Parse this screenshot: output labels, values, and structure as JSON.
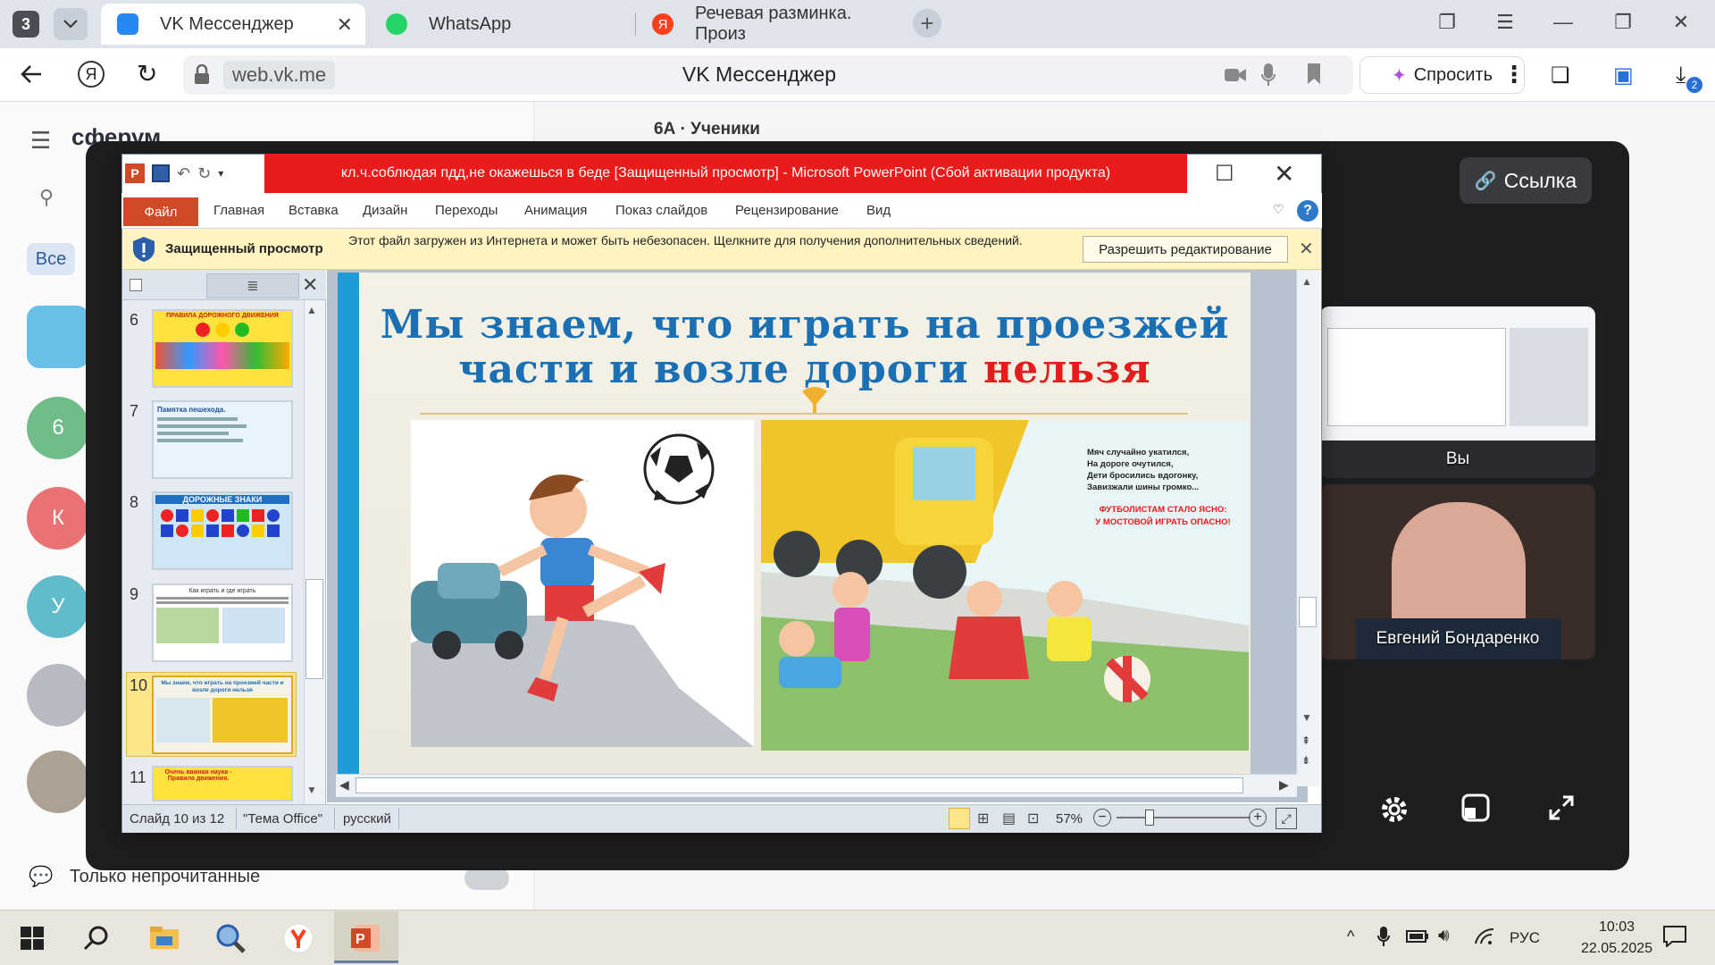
{
  "browser": {
    "tab_count": "3",
    "tabs": [
      {
        "title": "VK Мессенджер",
        "active": true
      },
      {
        "title": "WhatsApp",
        "active": false
      },
      {
        "title": "Речевая разминка. Произ",
        "active": false
      }
    ],
    "url": "web.vk.me",
    "page_title": "VK Мессенджер",
    "ask_button": "Спросить",
    "downloads_badge": "2"
  },
  "vk": {
    "logo": "сферум",
    "chat_title": "6А · Ученики",
    "filter_all": "Все",
    "avatars": [
      "6",
      "К",
      "У"
    ],
    "unread_only": "Только непрочитанные"
  },
  "call": {
    "link_button": "Ссылка",
    "participants": [
      {
        "name": "Вы"
      },
      {
        "name": "Евгений Бондаренко"
      }
    ]
  },
  "ppt": {
    "window_title": "кл.ч.соблюдая  пдд,не окажешься в беде [Защищенный просмотр]  -  Microsoft PowerPoint (Сбой активации продукта)",
    "ribbon": {
      "file": "Файл",
      "tabs": [
        "Главная",
        "Вставка",
        "Дизайн",
        "Переходы",
        "Анимация",
        "Показ слайдов",
        "Рецензирование",
        "Вид"
      ]
    },
    "protected": {
      "title": "Защищенный просмотр",
      "message": "Этот файл загружен из Интернета и может быть небезопасен. Щелкните для получения дополнительных сведений.",
      "enable_button": "Разрешить редактирование"
    },
    "thumbnails": [
      {
        "num": "6",
        "caption": "ПРАВИЛА ДОРОЖНОГО ДВИЖЕНИЯ"
      },
      {
        "num": "7",
        "caption": "Памятка пешехода."
      },
      {
        "num": "8",
        "caption": "ДОРОЖНЫЕ ЗНАКИ"
      },
      {
        "num": "9",
        "caption": "Как играть и где играть"
      },
      {
        "num": "10",
        "caption": "Мы знаем, что играть на проезжей части и возле дороги нельзя"
      },
      {
        "num": "11",
        "caption": "Очень важная наука - Правила движения."
      }
    ],
    "slide": {
      "title_line1": "Мы знаем, что играть на проезжей",
      "title_line2_pre": "части и возле дороги ",
      "title_line2_red": "нельзя",
      "poem": [
        "Мяч случайно укатился,",
        "На дороге очутился,",
        "Дети бросились вдогонку,",
        "Завизжали шины громко..."
      ],
      "poem_red": [
        "ФУТБОЛИСТАМ СТАЛО ЯСНО:",
        "У МОСТОВОЙ ИГРАТЬ ОПАСНО!"
      ]
    },
    "status": {
      "slide_info": "Слайд 10 из 12",
      "theme": "\"Тема Office\"",
      "language": "русский",
      "zoom": "57%"
    }
  },
  "taskbar": {
    "lang": "РУС",
    "time": "10:03",
    "date": "22.05.2025"
  },
  "colors": {
    "ppt_title_bar": "#ea1b1b",
    "file_tab": "#d04a26",
    "slide_title": "#1b6fb3",
    "slide_accent_red": "#e31c1c",
    "call_bg": "#1d1e20"
  }
}
